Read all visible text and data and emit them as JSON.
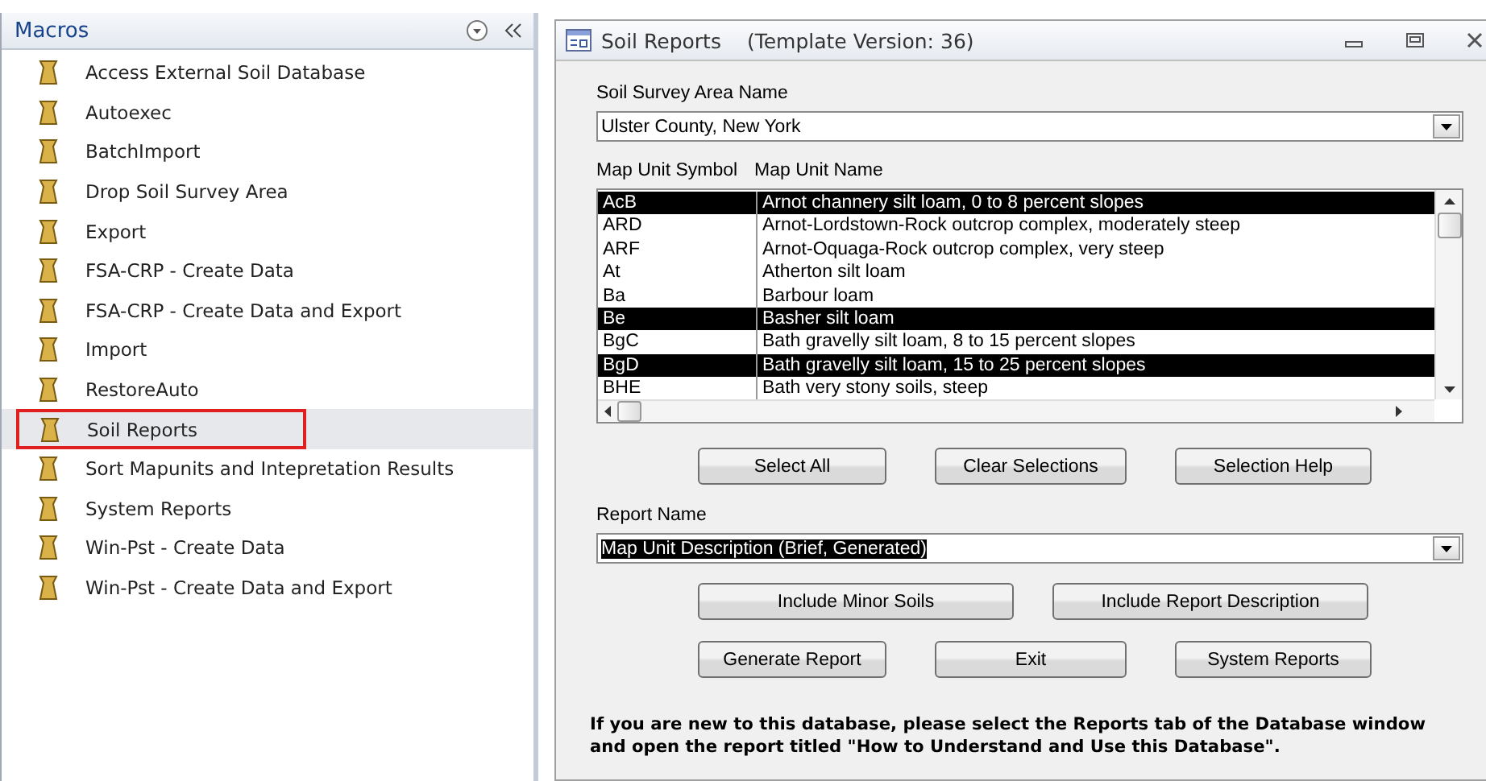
{
  "navigation_pane": {
    "title": "Macros",
    "items": [
      {
        "label": "Access External Soil Database",
        "selected": false
      },
      {
        "label": "Autoexec",
        "selected": false
      },
      {
        "label": "BatchImport",
        "selected": false
      },
      {
        "label": "Drop Soil Survey Area",
        "selected": false
      },
      {
        "label": "Export",
        "selected": false
      },
      {
        "label": "FSA-CRP - Create Data",
        "selected": false
      },
      {
        "label": "FSA-CRP - Create Data and Export",
        "selected": false
      },
      {
        "label": "Import",
        "selected": false
      },
      {
        "label": "RestoreAuto",
        "selected": false
      },
      {
        "label": "Soil Reports",
        "selected": true
      },
      {
        "label": "Sort Mapunits and Intepretation Results",
        "selected": false
      },
      {
        "label": "System Reports",
        "selected": false
      },
      {
        "label": "Win-Pst - Create Data",
        "selected": false
      },
      {
        "label": "Win-Pst - Create Data and Export",
        "selected": false
      }
    ]
  },
  "form": {
    "title": "Soil Reports",
    "subtitle": "(Template Version: 36)",
    "survey_area": {
      "label": "Soil Survey Area Name",
      "value": "Ulster County, New York"
    },
    "map_units": {
      "columns": [
        "Map Unit Symbol",
        "Map Unit Name"
      ],
      "rows": [
        {
          "symbol": "AcB",
          "name": "Arnot channery silt loam, 0 to 8 percent slopes",
          "selected": true
        },
        {
          "symbol": "ARD",
          "name": "Arnot-Lordstown-Rock outcrop complex, moderately steep",
          "selected": false
        },
        {
          "symbol": "ARF",
          "name": "Arnot-Oquaga-Rock outcrop complex, very steep",
          "selected": false
        },
        {
          "symbol": "At",
          "name": "Atherton silt loam",
          "selected": false
        },
        {
          "symbol": "Ba",
          "name": "Barbour loam",
          "selected": false
        },
        {
          "symbol": "Be",
          "name": "Basher silt loam",
          "selected": true
        },
        {
          "symbol": "BgC",
          "name": "Bath gravelly silt loam, 8 to 15 percent slopes",
          "selected": false
        },
        {
          "symbol": "BgD",
          "name": "Bath gravelly silt loam, 15 to 25 percent slopes",
          "selected": true
        },
        {
          "symbol": "BHE",
          "name": "Bath very stony soils, steep",
          "selected": false
        }
      ]
    },
    "selection_buttons": [
      "Select All",
      "Clear Selections",
      "Selection Help"
    ],
    "report": {
      "label": "Report Name",
      "value": "Map Unit Description (Brief, Generated)"
    },
    "option_buttons": [
      "Include Minor Soils",
      "Include Report Description"
    ],
    "action_buttons": [
      "Generate Report",
      "Exit",
      "System Reports"
    ],
    "note": "If you are new to this database, please select the Reports tab of the Database window and open the report titled \"How to Understand and Use this Database\"."
  }
}
